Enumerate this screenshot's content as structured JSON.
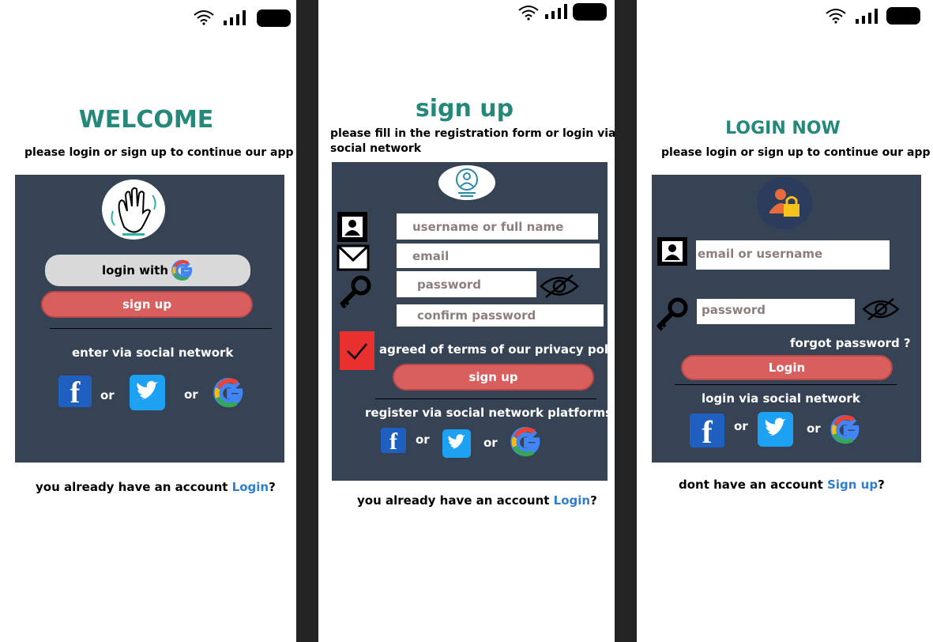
{
  "screens": {
    "welcome": {
      "title": "WELCOME",
      "subtitle": "please login or sign up to continue our app",
      "login_with": "login with",
      "sign_up": "sign up",
      "enter_via": "enter via  social network",
      "or1": "or",
      "or2": "or",
      "footer_text": "you already have an account ",
      "footer_link": "Login",
      "footer_q": "?"
    },
    "signup": {
      "title": "sign up",
      "subtitle_line1": "please fill in the registration form or login via",
      "subtitle_line2": "social network",
      "username_placeholder": "username or full name",
      "email_placeholder": "email",
      "password_placeholder": "password",
      "confirm_placeholder": "confirm password",
      "agree_text": "agreed of terms of our privacy policy",
      "sign_up": "sign up",
      "register_via": "register via  social network platforms",
      "or1": "or",
      "or2": "or",
      "footer_text": "you already have an account ",
      "footer_link": "Login",
      "footer_q": "?"
    },
    "login": {
      "title": "LOGIN NOW",
      "subtitle": "please login or sign up to continue our app",
      "email_placeholder": "email or username",
      "password_placeholder": "password",
      "forgot": "forgot password ?",
      "login_button": "Login",
      "login_via": "login via  social network",
      "or1": "or",
      "or2": "or",
      "footer_text": "dont have an account ",
      "footer_link": "Sign up",
      "footer_q": "?"
    }
  },
  "colors": {
    "teal": "#24897a",
    "panel": "#354354",
    "red_button": "#d95f5f",
    "link_blue": "#2f7fd1",
    "checkbox_red": "#e8302f"
  },
  "icons": [
    "wifi-icon",
    "signal-icon",
    "battery-icon",
    "wave-hand-icon",
    "google-icon",
    "facebook-icon",
    "twitter-icon",
    "user-card-icon",
    "mail-icon",
    "key-icon",
    "eye-off-icon",
    "check-icon",
    "user-lock-icon"
  ]
}
